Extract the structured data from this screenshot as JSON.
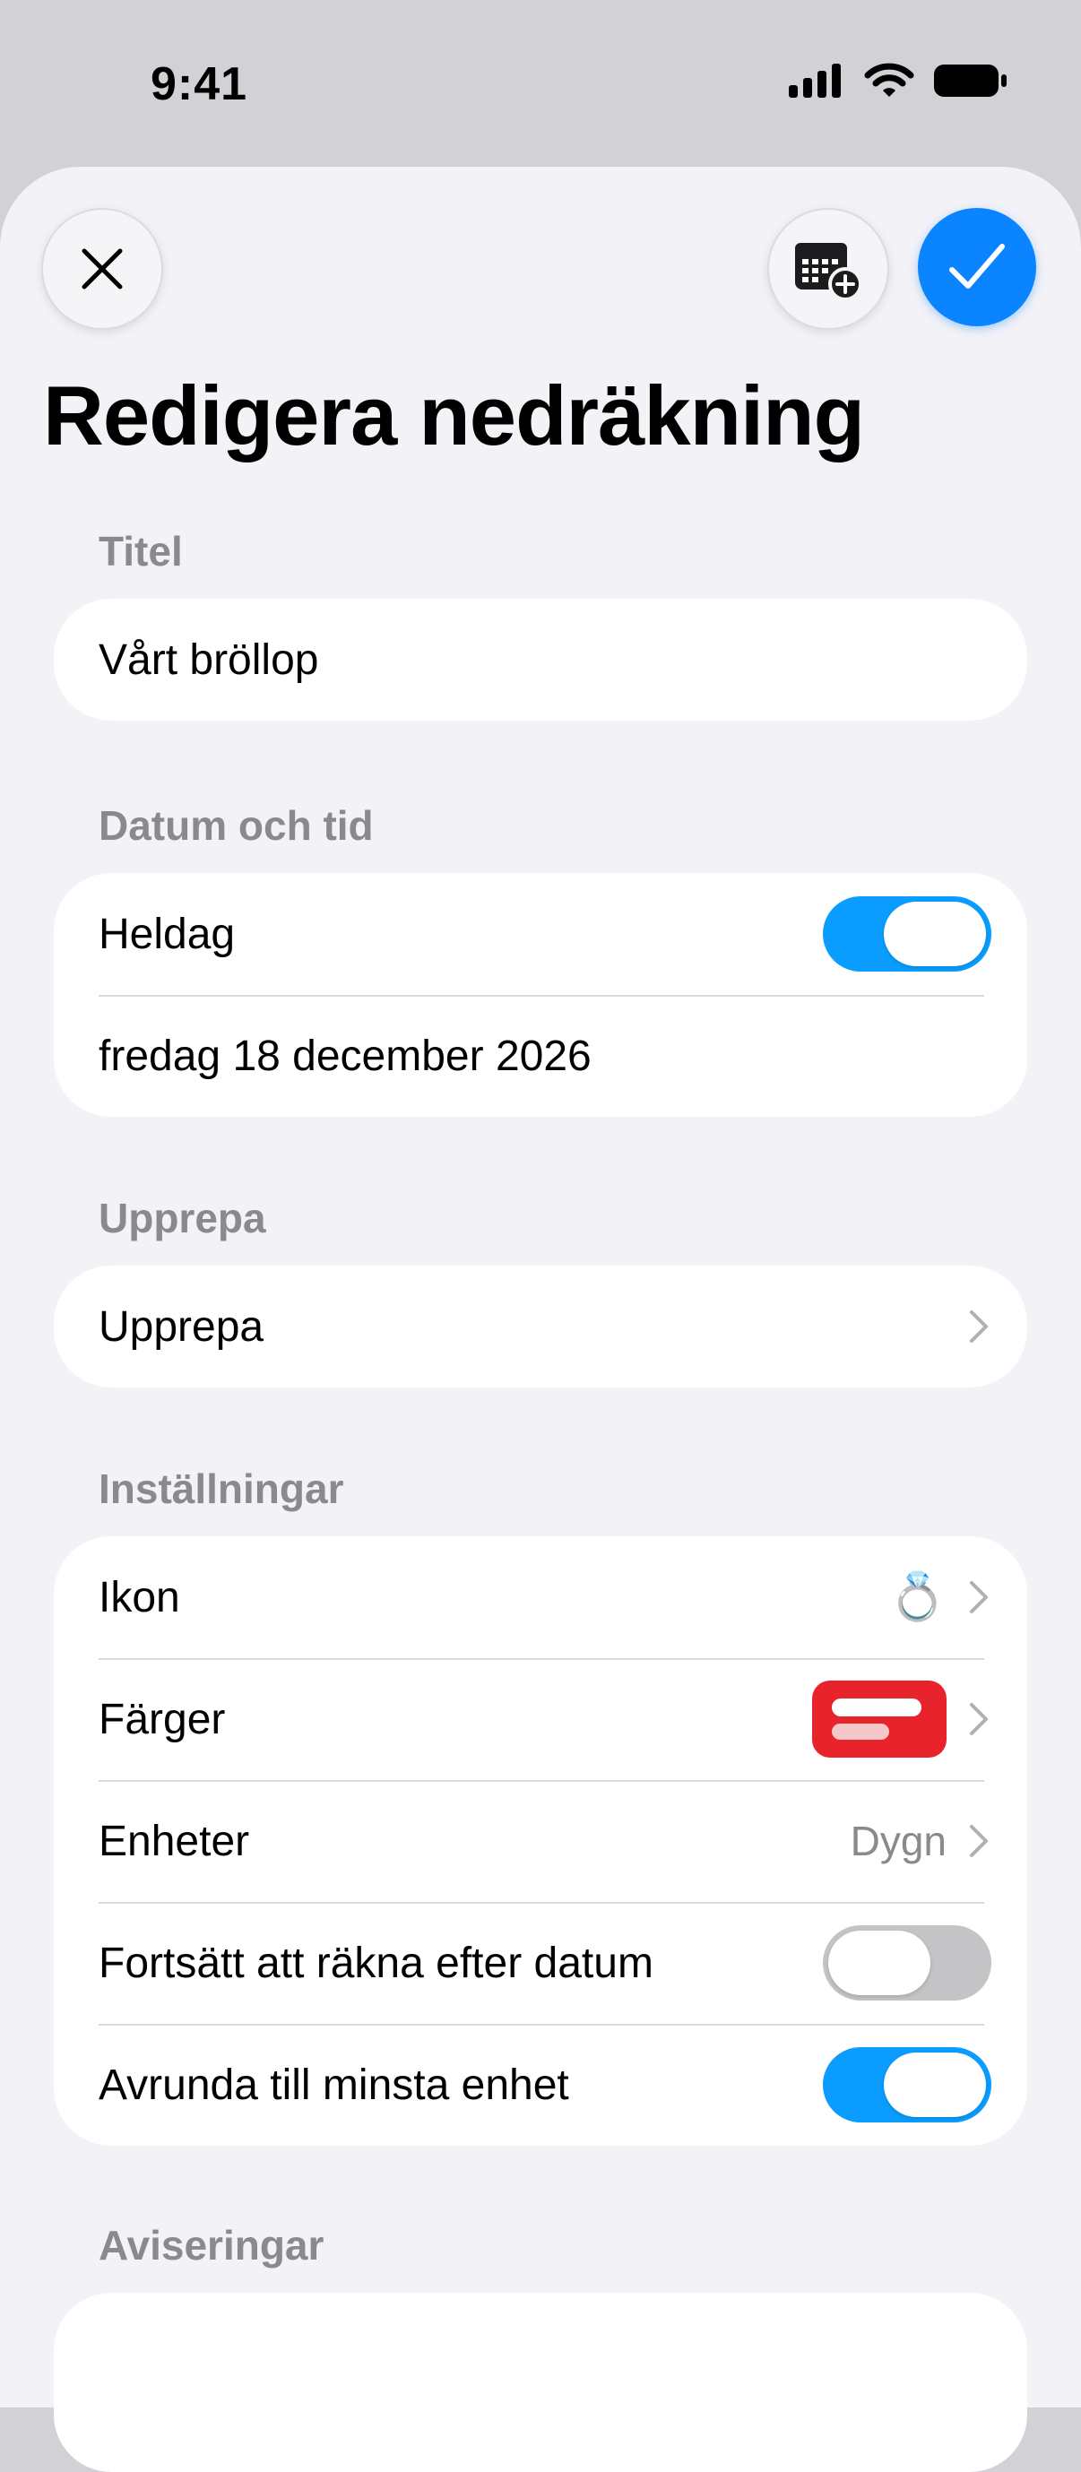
{
  "status_bar": {
    "time": "9:41"
  },
  "header": {
    "title": "Redigera nedräkning"
  },
  "title_section": {
    "label": "Titel",
    "value": "Vårt bröllop"
  },
  "date_section": {
    "label": "Datum och tid",
    "all_day_label": "Heldag",
    "all_day_on": true,
    "date_value": "fredag 18 december 2026"
  },
  "repeat_section": {
    "label": "Upprepa",
    "row_label": "Upprepa"
  },
  "settings_section": {
    "label": "Inställningar",
    "icon_label": "Ikon",
    "icon_value": "💍",
    "colors_label": "Färger",
    "color_accent": "#e8232c",
    "units_label": "Enheter",
    "units_value": "Dygn",
    "continue_label": "Fortsätt att räkna efter datum",
    "continue_on": false,
    "round_label": "Avrunda till minsta enhet",
    "round_on": true
  },
  "notifications_section": {
    "label": "Aviseringar"
  },
  "colors": {
    "accent": "#0a84ff",
    "toggle_on": "#0a9dff"
  }
}
